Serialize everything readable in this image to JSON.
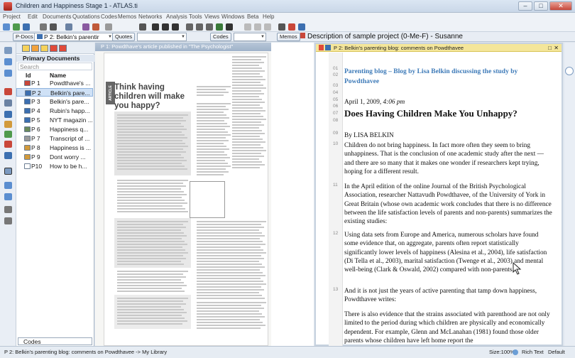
{
  "window": {
    "title": "Children and Happiness Stage 1 - ATLAS.ti",
    "controls": [
      "–",
      "□",
      "✕"
    ]
  },
  "menubar": [
    "Project",
    "Edit",
    "Documents",
    "Quotations",
    "Codes",
    "Memos",
    "Networks",
    "Analysis",
    "Tools",
    "Views",
    "Windows",
    "Beta",
    "Help"
  ],
  "docbar": {
    "pdocs_label": "P-Docs",
    "pdoc_selected": "P 2: Belkin's parentir",
    "quotes_label": "Quotes",
    "codes_label": "Codes",
    "memos_label": "Memos",
    "memo_selected": "Description of sample project (0-Me-F) - Susanne"
  },
  "navigator": {
    "header": "Primary Documents",
    "search_placeholder": "Search",
    "col_id": "Id",
    "col_name": "Name",
    "rows": [
      {
        "id": "P 1",
        "name": "Powdthave's ...",
        "color": "#c9473a"
      },
      {
        "id": "P 2",
        "name": "Belkin's pare...",
        "color": "#3c6fb0"
      },
      {
        "id": "P 3",
        "name": "Belkin's pare...",
        "color": "#3c6fb0"
      },
      {
        "id": "P 4",
        "name": "Rubin's happ...",
        "color": "#3c6fb0"
      },
      {
        "id": "P 5",
        "name": "NYT magazin ...",
        "color": "#3c6fb0"
      },
      {
        "id": "P 6",
        "name": "Happiness q...",
        "color": "#6a8a5a"
      },
      {
        "id": "P 7",
        "name": "Transcript of ...",
        "color": "#9a9a9a"
      },
      {
        "id": "P 8",
        "name": "Happiness is ...",
        "color": "#d29a3c"
      },
      {
        "id": "P 9",
        "name": "Dont worry ...",
        "color": "#d29a3c"
      },
      {
        "id": "P10",
        "name": "How to be h...",
        "color": "#ffffff"
      }
    ],
    "codes_label": "Codes"
  },
  "paneA": {
    "title": "P 1: Powdthave's article published in \"The Psychologist\"",
    "article_tab": "ARTICLE",
    "headline": "Think having children will make you happy?"
  },
  "paneB": {
    "title": "P 2: Belkin's parenting blog: comments on Powdthavee",
    "line_numbers": [
      "01",
      "02",
      "03",
      "04",
      "05",
      "06",
      "07",
      "08",
      "09",
      "10",
      "11",
      "12",
      "13"
    ],
    "blog_heading": "Parenting blog – Blog by Lisa Belkin discussing the study by Powdthavee",
    "date": "April 1, 2009, ",
    "time": "4:06 pm",
    "article_title": "Does Having Children Make You Unhappy?",
    "byline": "By LISA BELKIN",
    "p1": "Children do not bring happiness. In fact more often they seem to bring unhappiness. That is the conclusion of one academic study after the next — and there are so many that it makes one wonder if researchers kept trying, hoping for a different result.",
    "p2": "In the April edition of the online Journal of the British Psychological Association, researcher Nattavudh Powdthavee, of the University of York in Great Britain (whose own academic work concludes that there is no difference between the life satisfaction levels of parents and non-parents) summarizes the existing studies:",
    "p3": "Using data sets from Europe and America, numerous scholars have found some evidence that, on aggregate, parents often report statistically significantly lower levels of happiness (Alesina et al., 2004), life satisfaction (Di Tella et al., 2003), marital satisfaction (Twenge et al., 2003) and mental well-being (Clark & Oswald, 2002) compared with non-parents.",
    "p4": "And it is not just the years of active parenting that tamp down happiness, Powdthavee writes:",
    "p5": "There is also evidence that the strains associated with parenthood are not only limited to the period during which children are physically and economically dependent. For example, Glenn and McLanahan (1981) found those older parents whose children have left home report the"
  },
  "statusbar": {
    "left": "P 2: Belkin's parenting blog: comments on Powdthavee -> My Library",
    "size": "Size:100%",
    "mode": "Rich Text",
    "lang": "Default"
  }
}
